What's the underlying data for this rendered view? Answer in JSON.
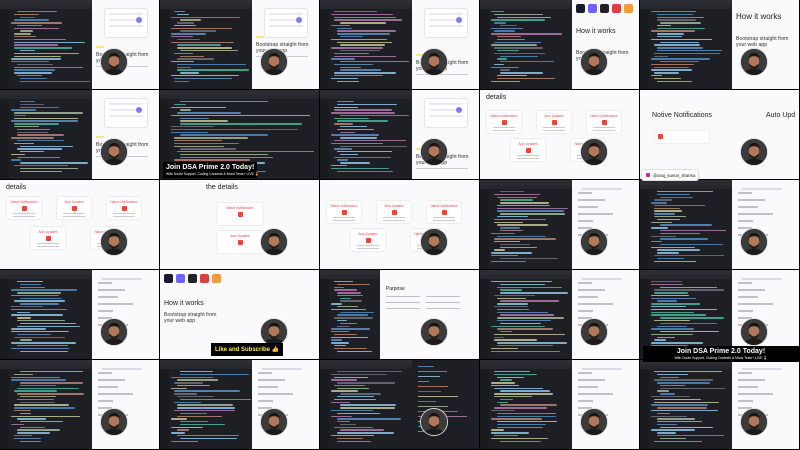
{
  "grid": {
    "rows": 5,
    "columns": 5
  },
  "colors": {
    "editor_bg": "#1e1f24",
    "web_bg": "#fafafc",
    "accent_purple": "#7f7de8",
    "highlight_yellow": "#ffe27a",
    "notification_red": "#e14b5f",
    "caption_yellow": "#ffeb3b"
  },
  "texts": {
    "hero_line1": "Bootstrap straight from",
    "hero_line2": "your web app",
    "hero_line3": "your web app",
    "how_it_works": "How it works",
    "details": "details",
    "the_details": "the details",
    "native_notifications": "Native Notifications",
    "native_notifications_alt": "Notive Notifications",
    "auto_updates": "Auto Updates",
    "auto_upd": "Auto Upd",
    "instagram_handle": "@anuj_kumar_sharma",
    "join_title": "Join DSA Prime 2.0 Today!",
    "join_sub": "With Doubt Support, Coding Contests & Mock Tests+ LIVE 🎖️",
    "like_subscribe": "Like and Subscribe 👍",
    "purpose": "Purpose"
  },
  "icons": {
    "face_cam": "person-avatar-icon",
    "instagram": "instagram-icon",
    "app_logo": "app-logo-icon"
  }
}
